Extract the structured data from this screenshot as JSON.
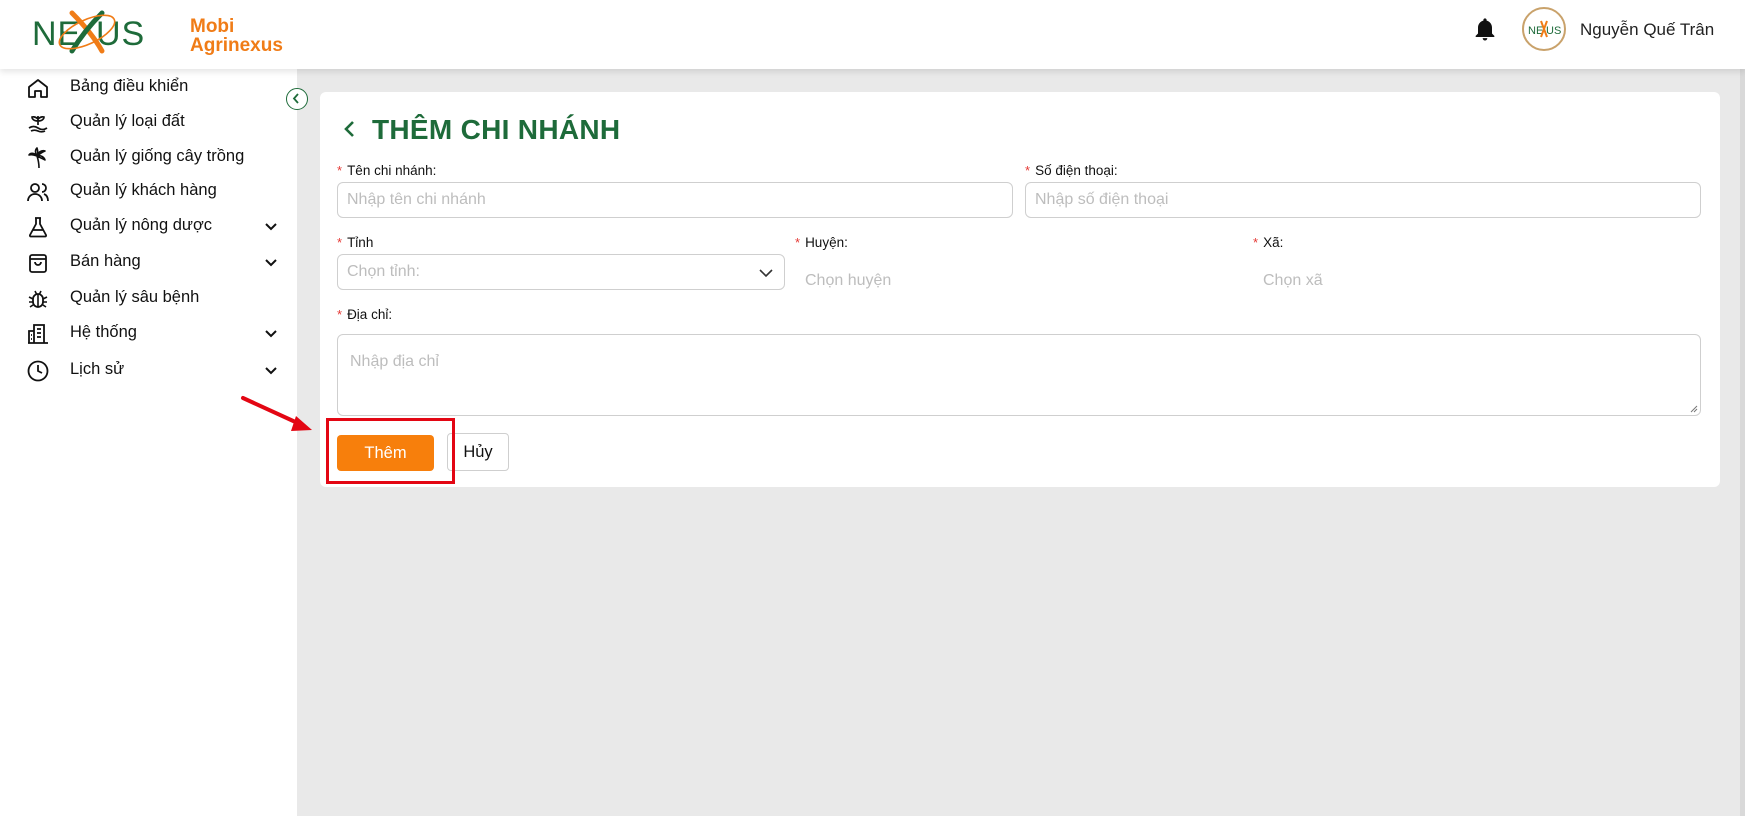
{
  "brand": {
    "logo_text": "NEXUS",
    "line1": "Mobi",
    "line2": "Agrinexus",
    "primary_color": "#1e6b3a",
    "accent_color": "#f07c17"
  },
  "header": {
    "user_name": "Nguyễn Quế Trân"
  },
  "sidebar": {
    "items": [
      {
        "label": "Bảng điều khiển",
        "icon": "home-icon",
        "has_chevron": false
      },
      {
        "label": "Quản lý loại đất",
        "icon": "soil-icon",
        "has_chevron": false
      },
      {
        "label": "Quản lý giống cây trồng",
        "icon": "palm-tree-icon",
        "has_chevron": false
      },
      {
        "label": "Quản lý khách hàng",
        "icon": "users-icon",
        "has_chevron": false
      },
      {
        "label": "Quản lý nông dược",
        "icon": "flask-icon",
        "has_chevron": true
      },
      {
        "label": "Bán hàng",
        "icon": "shopping-bag-icon",
        "has_chevron": true
      },
      {
        "label": "Quản lý sâu bệnh",
        "icon": "bug-icon",
        "has_chevron": false
      },
      {
        "label": "Hệ thống",
        "icon": "building-icon",
        "has_chevron": true
      },
      {
        "label": "Lịch sử",
        "icon": "clock-icon",
        "has_chevron": true
      }
    ]
  },
  "form": {
    "title": "THÊM CHI NHÁNH",
    "branch_name": {
      "label": "Tên chi nhánh:",
      "placeholder": "Nhập tên chi nhánh"
    },
    "phone": {
      "label": "Số điện thoại:",
      "placeholder": "Nhập số điện thoại"
    },
    "province": {
      "label": "Tỉnh",
      "placeholder": "Chọn tỉnh:"
    },
    "district": {
      "label": "Huyện:",
      "placeholder": "Chọn huyện"
    },
    "ward": {
      "label": "Xã:",
      "placeholder": "Chọn xã"
    },
    "address": {
      "label": "Địa chỉ:",
      "placeholder": "Nhập địa chỉ"
    },
    "required_mark": "*",
    "add_button": "Thêm",
    "cancel_button": "Hủy"
  }
}
